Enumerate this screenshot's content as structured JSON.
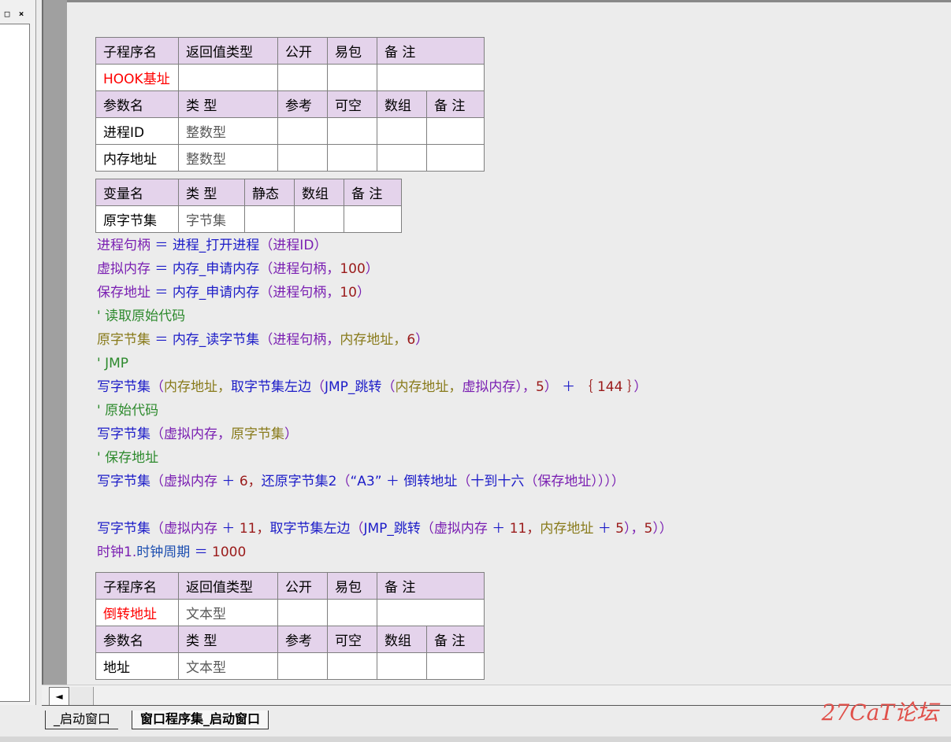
{
  "window": {
    "restore_label": "□",
    "close_label": "×"
  },
  "table1": {
    "header": [
      "子程序名",
      "返回值类型",
      "公开",
      "易包",
      "备 注"
    ],
    "row": [
      "HOOK基址",
      "",
      "",
      "",
      ""
    ],
    "param_header": [
      "参数名",
      "类 型",
      "参考",
      "可空",
      "数组",
      "备 注"
    ],
    "params": [
      [
        "进程ID",
        "整数型",
        "",
        "",
        "",
        ""
      ],
      [
        "内存地址",
        "整数型",
        "",
        "",
        "",
        ""
      ]
    ]
  },
  "vartable": {
    "header": [
      "变量名",
      "类 型",
      "静态",
      "数组",
      "备 注"
    ],
    "rows": [
      [
        "原字节集",
        "字节集",
        "",
        "",
        ""
      ]
    ]
  },
  "code": {
    "l1": {
      "v": "进程句柄",
      "op": " ＝ ",
      "f": "进程_打开进程",
      "a": "（",
      "p": "进程ID",
      "b": "）"
    },
    "l2": {
      "v": "虚拟内存",
      "op": " ＝ ",
      "f": "内存_申请内存",
      "a": "（",
      "p": "进程句柄，",
      "n": "100",
      "b": "）"
    },
    "l3": {
      "v": "保存地址",
      "op": " ＝ ",
      "f": "内存_申请内存",
      "a": "（",
      "p": "进程句柄，",
      "n": "10",
      "b": "）"
    },
    "c1": "' 读取原始代码",
    "l4": {
      "v": "原字节集",
      "op": " ＝ ",
      "f": "内存_读字节集",
      "a": "（",
      "p1": "进程句柄，",
      "p2": "内存地址，",
      "n": "6",
      "b": "）"
    },
    "c2": "' JMP",
    "l5": {
      "f": "写字节集",
      "a": "（",
      "p1": "内存地址，",
      "f2": "取字节集左边",
      "a2": "（",
      "f3": "JMP_跳转",
      "a3": "（",
      "p2": "内存地址，",
      "p3": "虚拟内存",
      "b1": "），",
      "n1": "5",
      "b2": "）",
      "op": " ＋ ",
      "br": "｛",
      "n2": " 144 ",
      "bb": "｝",
      "e": "）"
    },
    "c3": "' 原始代码",
    "l6": {
      "f": "写字节集",
      "a": "（",
      "p1": "虚拟内存，",
      "p2": "原字节集",
      "b": "）"
    },
    "c4": "' 保存地址",
    "l7": {
      "f": "写字节集",
      "a": "（",
      "p1": "虚拟内存",
      "op": " ＋ ",
      "n": "6，",
      "f2": "还原字节集2",
      "a2": "（",
      "s": "“A3”",
      "op2": " ＋ ",
      "f3": "倒转地址",
      "a3": "（",
      "f4": "十到十六",
      "a4": "（",
      "p2": "保存地址",
      "e": "））））"
    },
    "l8": {
      "f": "写字节集",
      "a": "（",
      "p1": "虚拟内存",
      "op": " ＋ ",
      "n": "11，",
      "f2": "取字节集左边",
      "a2": "（",
      "f3": "JMP_跳转",
      "a3": "（",
      "p2": "虚拟内存",
      "op2": " ＋ ",
      "n2": "11，",
      "p3": "内存地址",
      "op3": " ＋ ",
      "n3": "5",
      "b": "），",
      "n4": "5",
      "e": "））"
    },
    "l9": {
      "obj": "时钟1.",
      "prop": "时钟周期",
      "op": " ＝ ",
      "n": "1000"
    }
  },
  "table2": {
    "header": [
      "子程序名",
      "返回值类型",
      "公开",
      "易包",
      "备 注"
    ],
    "row": [
      "倒转地址",
      "文本型",
      "",
      "",
      ""
    ],
    "param_header": [
      "参数名",
      "类 型",
      "参考",
      "可空",
      "数组",
      "备 注"
    ],
    "params": [
      [
        "地址",
        "文本型",
        "",
        "",
        "",
        ""
      ]
    ]
  },
  "tabs": [
    "_启动窗口",
    "窗口程序集_启动窗口"
  ],
  "scroll": {
    "left_arrow": "◄"
  },
  "watermark": "27CaT论坛"
}
